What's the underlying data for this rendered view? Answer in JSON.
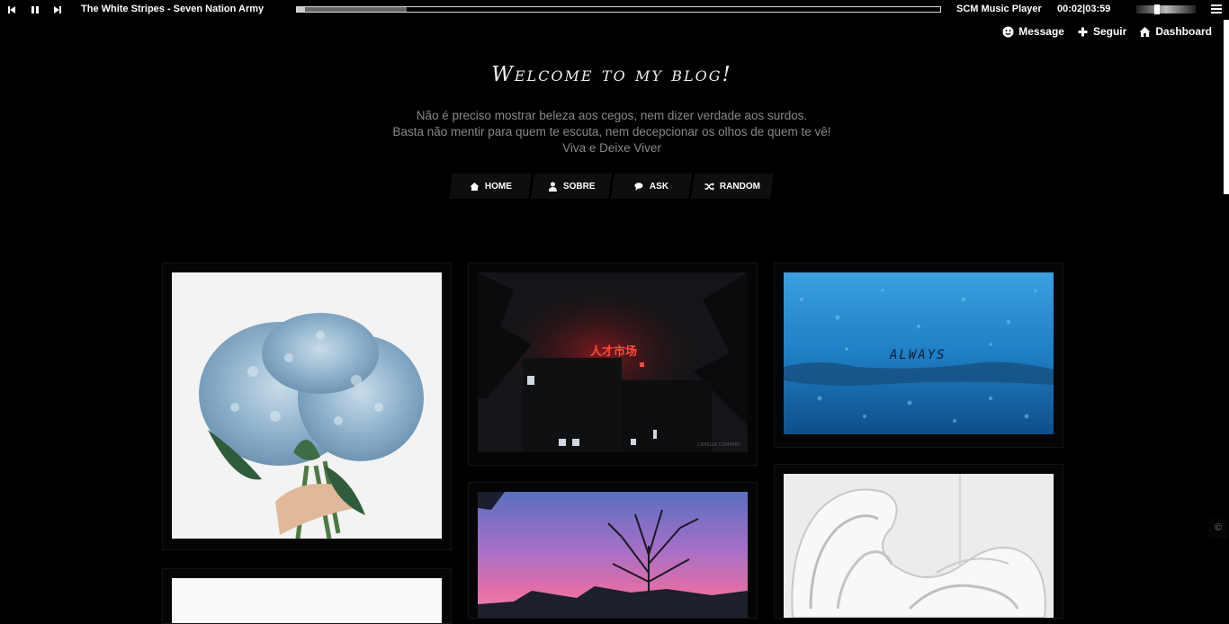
{
  "music_player": {
    "track_title": "The White Stripes - Seven Nation Army",
    "player_name": "SCM Music Player",
    "time": "00:02|03:59",
    "progress_played": 0.012,
    "progress_buffered": 0.17,
    "volume": 0.35
  },
  "controls": {
    "message": "Message",
    "follow": "Seguir",
    "dashboard": "Dashboard"
  },
  "blog": {
    "title": "Welcome to my blog!",
    "description_lines": [
      "Não é preciso mostrar beleza aos cegos, nem dizer verdade aos surdos.",
      "Basta não mentir para quem te escuta, nem decepcionar os olhos de quem te vê!",
      "Viva e Deixe Viver"
    ]
  },
  "nav": {
    "home": "HOME",
    "about": "SOBRE",
    "ask": "ASK",
    "random": "RANDOM"
  },
  "posts": {
    "rain_window_text": "ALWAYS",
    "neon_sign_text": "人才市场",
    "photo_watermark": "CARELLE COMPANY"
  },
  "footer": {
    "copyright_symbol": "©"
  },
  "colors": {
    "background": "#000000",
    "post_background": "#050505",
    "nav_background": "#0e0e0e",
    "description_text": "#888888"
  }
}
